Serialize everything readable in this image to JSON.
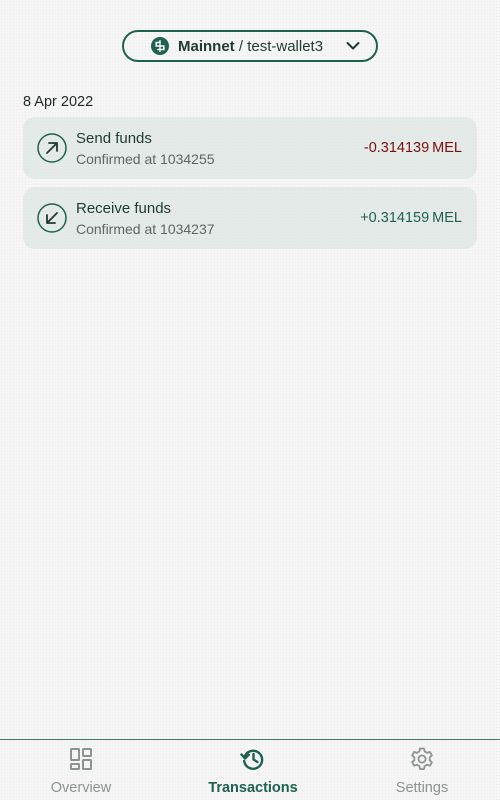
{
  "colors": {
    "accent": "#1f6150",
    "negative": "#7a1010",
    "positive": "#1f6150",
    "muted": "#8a9490"
  },
  "network_selector": {
    "icon": "mel-logo-icon",
    "network": "Mainnet",
    "separator": " / ",
    "wallet": "test-wallet3",
    "dropdown_icon": "chevron-down-icon"
  },
  "transactions": {
    "date_header": "8 Apr 2022",
    "items": [
      {
        "direction": "send",
        "icon": "arrow-up-right-icon",
        "title": "Send funds",
        "subtitle": "Confirmed at 1034255",
        "amount": "-0.314139",
        "unit": "MEL"
      },
      {
        "direction": "receive",
        "icon": "arrow-down-left-icon",
        "title": "Receive funds",
        "subtitle": "Confirmed at 1034237",
        "amount": "+0.314159",
        "unit": "MEL"
      }
    ]
  },
  "bottom_nav": {
    "items": [
      {
        "label": "Overview",
        "icon": "dashboard-icon",
        "active": false
      },
      {
        "label": "Transactions",
        "icon": "history-icon",
        "active": true
      },
      {
        "label": "Settings",
        "icon": "gear-icon",
        "active": false
      }
    ]
  }
}
